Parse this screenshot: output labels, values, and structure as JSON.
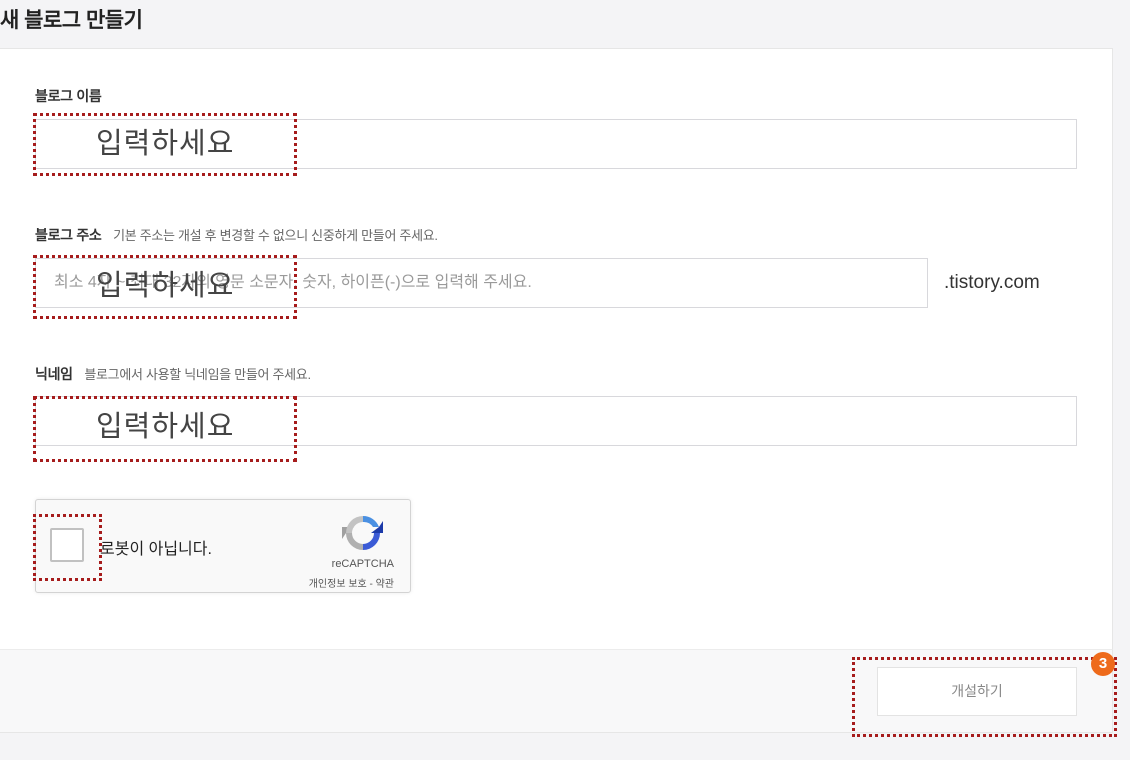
{
  "page": {
    "title": "새 블로그 만들기"
  },
  "form": {
    "blog_name": {
      "label": "블로그 이름",
      "hint": "",
      "value": ""
    },
    "blog_address": {
      "label": "블로그 주소",
      "hint": "기본 주소는 개설 후 변경할 수 없으니 신중하게 만들어 주세요.",
      "placeholder": "최소 4자 ~ 최대 32자의 영문 소문자, 숫자, 하이픈(-)으로 입력해 주세요.",
      "suffix": ".tistory.com"
    },
    "nickname": {
      "label": "닉네임",
      "hint": "블로그에서 사용할 닉네임을 만들어 주세요.",
      "value": ""
    }
  },
  "recaptcha": {
    "label": "로봇이 아닙니다.",
    "brand": "reCAPTCHA",
    "links": "개인정보 보호 - 약관",
    "checked": false
  },
  "footer": {
    "submit_label": "개설하기"
  },
  "annotations": {
    "input_overlay_text": "입력하세요",
    "step_badge": "3",
    "annotation_color": "#a61c1c",
    "badge_color": "#ee6a1b"
  }
}
